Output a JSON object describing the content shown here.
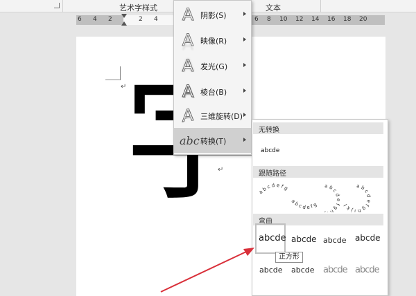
{
  "ribbon": {
    "group_wordart": "艺术字样式",
    "group_text": "文本"
  },
  "ruler": {
    "numbers": [
      "6",
      "4",
      "2",
      "2",
      "4",
      "6",
      "8",
      "10",
      "12",
      "14",
      "16",
      "18",
      "20"
    ]
  },
  "document": {
    "big_character": "字",
    "paragraph_mark": "↵"
  },
  "menu": {
    "items": [
      {
        "label": "阴影(S)",
        "icon": "text-shadow-icon"
      },
      {
        "label": "映像(R)",
        "icon": "text-reflection-icon"
      },
      {
        "label": "发光(G)",
        "icon": "text-glow-icon"
      },
      {
        "label": "棱台(B)",
        "icon": "text-bevel-icon"
      },
      {
        "label": "三维旋转(D)",
        "icon": "text-3d-rotation-icon"
      },
      {
        "label": "转换(T)",
        "icon": "text-transform-icon"
      }
    ],
    "active_index": 5
  },
  "gallery": {
    "section_none": "无转换",
    "none_sample": "abcde",
    "section_path": "跟随路径",
    "path_samples": [
      "abcdefg",
      "abcdefghij",
      "abcdefghijkl"
    ],
    "section_warp": "弯曲",
    "warp_samples": [
      "abcde",
      "abcde",
      "abcde",
      "abcde",
      "abcde",
      "abcde",
      "abcde",
      "abcde"
    ],
    "tooltip": "正方形"
  },
  "colors": {
    "annotation_arrow": "#d9303a",
    "menu_active": "#d0d0d0",
    "section_header": "#e4e4e4"
  }
}
